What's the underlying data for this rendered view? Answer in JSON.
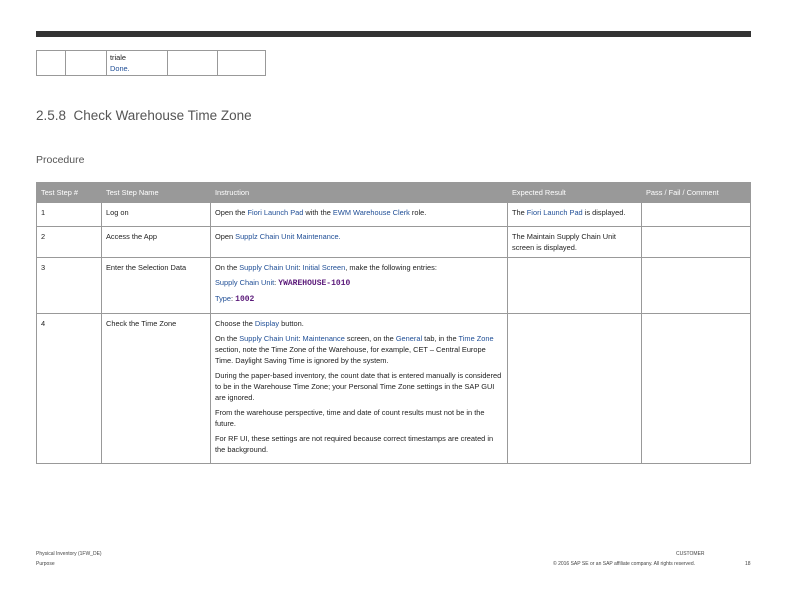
{
  "prev_table": {
    "cell_lines": [
      "triale",
      "Done."
    ]
  },
  "section": {
    "number": "2.5.8",
    "title": "Check Warehouse Time Zone"
  },
  "procedure_label": "Procedure",
  "table": {
    "headers": [
      "Test Step #",
      "Test Step Name",
      "Instruction",
      "Expected Result",
      "Pass / Fail / Comment"
    ],
    "rows": [
      {
        "step": "1",
        "name": "Log on",
        "instruction": [
          [
            [
              "Open the ",
              ""
            ],
            [
              "Fiori Launch Pad",
              "link"
            ],
            [
              " with the ",
              ""
            ],
            [
              "EWM Warehouse Clerk",
              "link"
            ],
            [
              " role.",
              ""
            ]
          ]
        ],
        "expected": [
          [
            "The ",
            ""
          ],
          [
            "Fiori Launch Pad",
            "link"
          ],
          [
            " is displayed.",
            ""
          ]
        ],
        "comment": ""
      },
      {
        "step": "2",
        "name": "Access the App",
        "instruction": [
          [
            [
              "Open ",
              ""
            ],
            [
              "Supplz Chain Unit Maintenance.",
              "link"
            ]
          ]
        ],
        "expected": [
          [
            "The Maintain Supply Chain Unit screen is displayed.",
            ""
          ]
        ],
        "comment": ""
      },
      {
        "step": "3",
        "name": "Enter the Selection Data",
        "instruction": [
          [
            [
              "On the ",
              ""
            ],
            [
              "Supply Chain Unit",
              "link"
            ],
            [
              ": ",
              ""
            ],
            [
              "Initial Screen",
              "link"
            ],
            [
              ", make the following entries:",
              ""
            ]
          ],
          [
            [
              "Supply Chain Unit",
              "link"
            ],
            [
              ": ",
              ""
            ],
            [
              "YWAREHOUSE-1010",
              "code"
            ]
          ],
          [
            [
              "Type",
              "link"
            ],
            [
              ": ",
              ""
            ],
            [
              "1002",
              "code"
            ]
          ]
        ],
        "expected": [],
        "comment": ""
      },
      {
        "step": "4",
        "name": "Check the Time Zone",
        "instruction": [
          [
            [
              "Choose the ",
              ""
            ],
            [
              "Display",
              "link"
            ],
            [
              " button.",
              ""
            ]
          ],
          [
            [
              "On the ",
              ""
            ],
            [
              "Supply Chain Unit",
              "link"
            ],
            [
              ": ",
              ""
            ],
            [
              "Maintenance",
              "link"
            ],
            [
              " screen, on the ",
              ""
            ],
            [
              "General",
              "link"
            ],
            [
              " tab, in the ",
              ""
            ],
            [
              "Time Zone",
              "link"
            ],
            [
              " section, note the Time Zone of the Warehouse, for example, CET – Central Europe Time. Daylight Saving Time is ignored by the system.",
              ""
            ]
          ],
          [
            [
              "During the paper-based inventory, the count date that is entered manually is considered to be in the Warehouse Time Zone; your Personal Time Zone settings in the SAP GUI are ignored.",
              ""
            ]
          ],
          [
            [
              "From the warehouse perspective, time and date of count results must not be in the future.",
              ""
            ]
          ],
          [
            [
              "For RF UI, these settings are not required because correct timestamps are created in the background.",
              ""
            ]
          ]
        ],
        "expected": [],
        "comment": ""
      }
    ]
  },
  "footer": {
    "left1": "Physical Inventory (1FW_DE)",
    "left2": "Purpose",
    "right1": "CUSTOMER",
    "right2": "© 2016 SAP SE or an SAP affiliate company. All rights reserved.",
    "page": "18"
  },
  "colors": {
    "link": "#1f4e96",
    "header_bg": "#999999",
    "code": "#5b1a7a"
  }
}
